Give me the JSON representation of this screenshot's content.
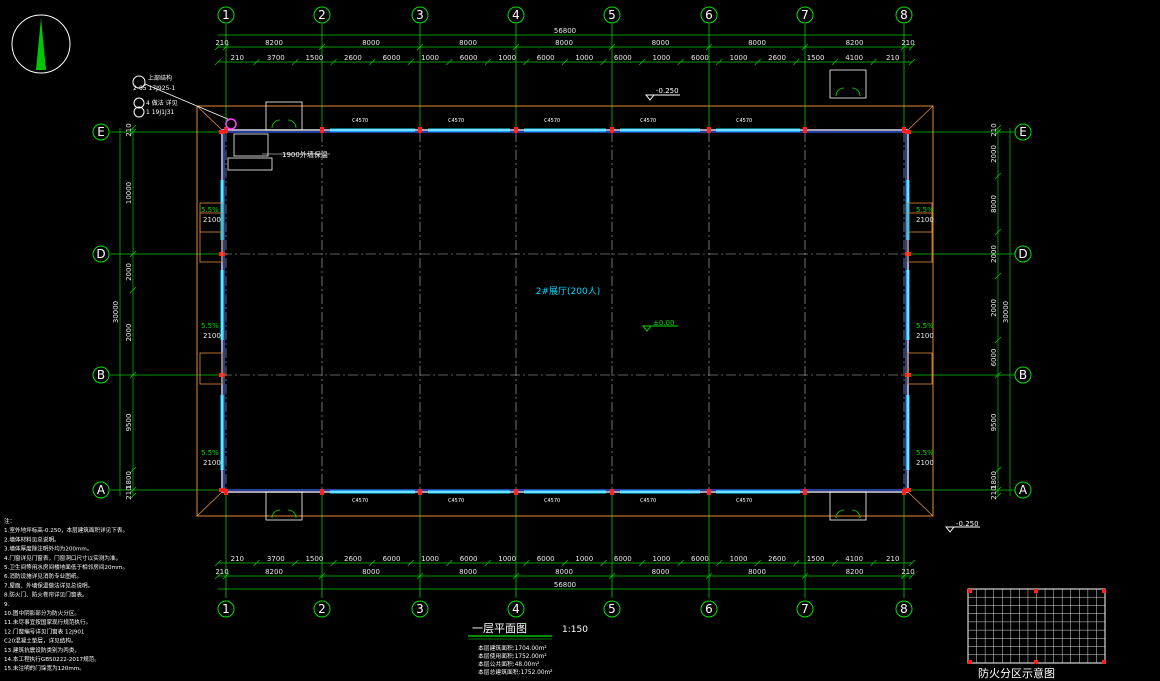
{
  "drawing": {
    "title": "一层平面图",
    "scale": "1:150",
    "room_label": "2#展厅(200人)",
    "elevation_top": "-0.250",
    "elevation_center": "±0.00",
    "elevation_right": "-0.250",
    "slope": "5.5%",
    "door_note": "1900外墙保温",
    "total_dim": "56800",
    "col_labels": [
      "1",
      "2",
      "3",
      "4",
      "5",
      "6",
      "7",
      "8"
    ],
    "row_labels": [
      "A",
      "B",
      "D",
      "E"
    ],
    "top_dims_1": [
      "210",
      "8200",
      "8000",
      "8000",
      "8000",
      "8000",
      "8000",
      "8200",
      "210"
    ],
    "top_dims_2": [
      "210",
      "3700",
      "1500",
      "2600",
      "6000",
      "1000",
      "6000",
      "1000",
      "6000",
      "1000",
      "6000",
      "1000",
      "6000",
      "1000",
      "2600",
      "1500",
      "4100",
      "210"
    ],
    "left_dims_outer": "30000",
    "left_dims": [
      "210",
      "10000",
      "2000",
      "2000",
      "9500",
      "1800",
      "210"
    ],
    "right_dims_outer": "30000",
    "right_dims": [
      "210",
      "2000",
      "8000",
      "2000",
      "2000",
      "6000",
      "9500",
      "1800",
      "210"
    ],
    "window_code": "C4570",
    "win_label": "2100",
    "legend_title": "防火分区示意图",
    "callout_1": "上部结构",
    "callout_2": "2-05 17J925-1",
    "callout_3": "4 做法 详见",
    "callout_4": "1 19J1J31",
    "notes": [
      "注：",
      "1.室外地坪标高-0.250，本层建筑面积详见下表。",
      "2.墙体材料见总说明。",
      "3.墙体厚度除注明外均为200mm。",
      "4.门窗详见门窗表，门窗洞口尺寸以实测为准。",
      "5.卫生间等用水房间楼地面低于相邻房间20mm。",
      "6.消防设施详见消防专业图纸。",
      "7.屋面、外墙保温做法详见总说明。",
      "8.防火门、防火卷帘详见门窗表。",
      "9.",
      "10.图中阴影部分为防火分区。",
      "11.未尽事宜按国家现行规范执行。",
      "12.门窗编号详见门窗表 12J901",
      "C20混凝土垫层，详见结构。",
      "13.建筑抗震设防类别为丙类，",
      "14.本工程执行GB50222-2017规范。",
      "15.未注明的门垛宽为120mm。"
    ],
    "area_stats": [
      "本层建筑面积:1704.00m²",
      "本层使用面积:1752.00m²",
      "本层公共面积:48.00m²",
      "本层总建筑面积:1752.00m²"
    ]
  }
}
